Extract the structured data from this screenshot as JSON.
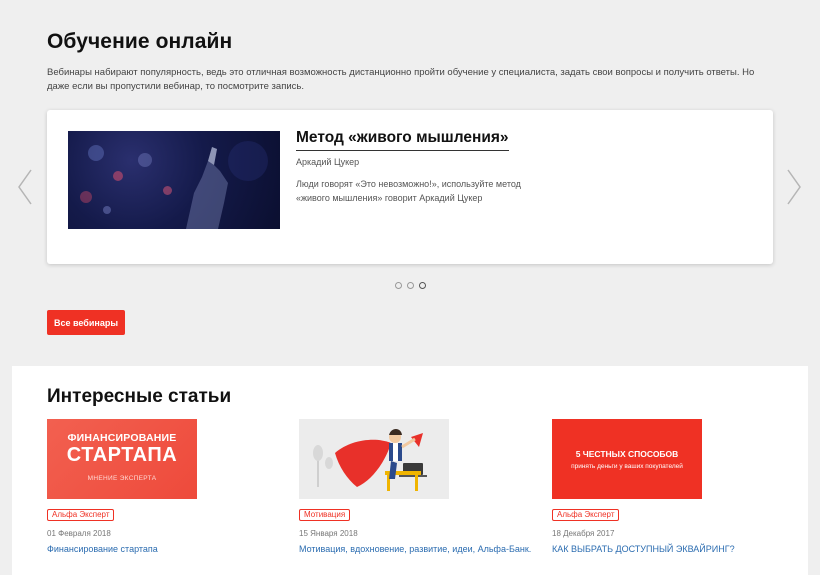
{
  "webinars": {
    "title": "Обучение онлайн",
    "intro": "Вебинары набирают популярность, ведь это отличная возможность дистанционно пройти обучение у специалиста, задать свои вопросы и получить ответы. Но даже если вы пропустили вебинар, то посмотрите запись.",
    "card": {
      "title": "Метод «живого мышления»",
      "author": "Аркадий Цукер",
      "description": "Люди говорят «Это невозможно!», используйте метод «живого мышления» говорит Аркадий Цукер"
    },
    "carousel": {
      "slide_count": 3,
      "active_index": 2
    },
    "all_button_label": "Все вебинары",
    "icons": {
      "prev": "chevron-left-icon",
      "next": "chevron-right-icon"
    }
  },
  "articles": {
    "title": "Интересные статьи",
    "items": [
      {
        "thumb_line1": "ФИНАНСИРОВАНИЕ",
        "thumb_line2": "СТАРТАПА",
        "thumb_line3": "МНЕНИЕ ЭКСПЕРТА",
        "badge": "Альфа Эксперт",
        "date": "01 Февраля 2018",
        "link": "Финансирование стартапа"
      },
      {
        "badge": "Мотивация",
        "date": "15 Января 2018",
        "link": "Мотивация, вдохновение, развитие, идеи, Альфа-Банк."
      },
      {
        "thumb_line1": "5 ЧЕСТНЫХ СПОСОБОВ",
        "thumb_line2": "принять деньги у ваших покупателей",
        "badge": "Альфа Эксперт",
        "date": "18 Декабря 2017",
        "link": "КАК ВЫБРАТЬ ДОСТУПНЫЙ ЭКВАЙРИНГ?"
      }
    ]
  },
  "colors": {
    "accent": "#ef3124",
    "link": "#2b6cb0",
    "page_bg": "#efefef"
  }
}
